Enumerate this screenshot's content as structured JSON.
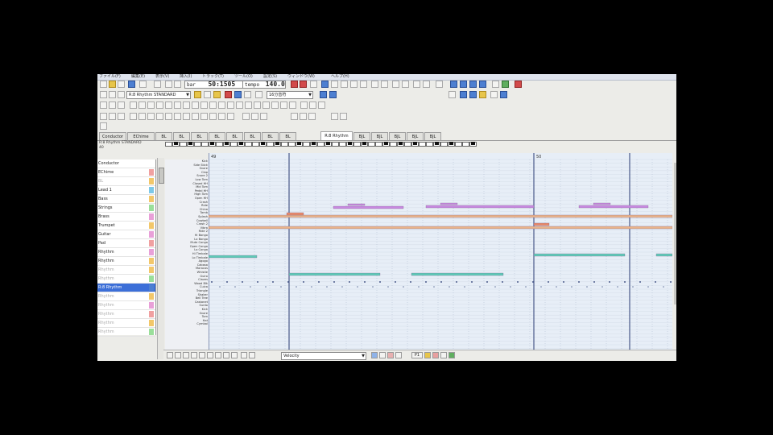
{
  "app": {
    "menu": [
      "ファイル(F)",
      "編集(E)",
      "表示(V)",
      "挿入(I)",
      "トラック(T)",
      "ツール(O)",
      "設定(S)",
      "ウィンドウ(W)",
      "ヘルプ(H)"
    ]
  },
  "transport": {
    "position_label": "bar",
    "position_value": "50:1505",
    "tempo_label": "tempo",
    "tempo_value": "140.00",
    "instrument_combo": "R:8 Rhythm STANDARD",
    "quantize_combo": "16分音符"
  },
  "tabs": [
    "Conductor",
    "EChime",
    "BL",
    "BL",
    "BL",
    "BL",
    "BL",
    "BL",
    "BL",
    "BL",
    "R:8 Rhythm",
    "BJL",
    "BJL",
    "BJL",
    "BJL",
    "BJL"
  ],
  "subheader": {
    "line1": "R:8 Rhythm STANDARD",
    "line2": "40"
  },
  "tracks": [
    {
      "label": "Conductor",
      "color": "#ffffff",
      "state": "normal"
    },
    {
      "label": "EChime",
      "color": "#f0a0a0",
      "state": "normal"
    },
    {
      "label": "BL",
      "color": "#f2c76a",
      "state": "dim"
    },
    {
      "label": "Lead 1",
      "color": "#7cc8e8",
      "state": "normal"
    },
    {
      "label": "Bass",
      "color": "#f2c76a",
      "state": "normal"
    },
    {
      "label": "Strings",
      "color": "#9adf9a",
      "state": "normal"
    },
    {
      "label": "Brass",
      "color": "#e8a0d8",
      "state": "normal"
    },
    {
      "label": "Trumpet",
      "color": "#f2c76a",
      "state": "normal"
    },
    {
      "label": "Guitar",
      "color": "#e8a0d8",
      "state": "normal"
    },
    {
      "label": "Pad",
      "color": "#f0a0a0",
      "state": "normal"
    },
    {
      "label": "Rhythm",
      "color": "#e8a0d8",
      "state": "normal"
    },
    {
      "label": "Rhythm",
      "color": "#f2c76a",
      "state": "normal"
    },
    {
      "label": "Rhythm",
      "color": "#f2c76a",
      "state": "dim"
    },
    {
      "label": "Rhythm",
      "color": "#9adf9a",
      "state": "dim"
    },
    {
      "label": "R:8 Rhythm",
      "color": "#4d7fd1",
      "state": "selected"
    },
    {
      "label": "Rhythm",
      "color": "#f2c76a",
      "state": "dim"
    },
    {
      "label": "Rhythm",
      "color": "#e8a0d8",
      "state": "dim"
    },
    {
      "label": "Rhythm",
      "color": "#f0a0a0",
      "state": "dim"
    },
    {
      "label": "Rhythm",
      "color": "#f2c76a",
      "state": "dim"
    },
    {
      "label": "Rhythm",
      "color": "#9adf9a",
      "state": "dim"
    }
  ],
  "note_names": [
    "Kick",
    "Side Stick",
    "Snare",
    "Clap",
    "Snare 2",
    "Low Tom",
    "Closed HH",
    "Mid Tom",
    "Pedal HH",
    "High Tom",
    "Open HH",
    "Crash",
    "Ride",
    "China",
    "Tamb",
    "Splash",
    "Cowbell",
    "Crash 2",
    "Vibra",
    "Ride 2",
    "Hi Bongo",
    "Lo Bongo",
    "Mute Conga",
    "Open Conga",
    "Lo Conga",
    "Hi Timbale",
    "Lo Timbale",
    "Agogo",
    "Cabasa",
    "Maracas",
    "Whistle",
    "Guiro",
    "Claves",
    "Wood Blk",
    "Cuica",
    "Triangle",
    "Shaker",
    "Bell Tree",
    "Castanet",
    "Surdo",
    "Kick",
    "Snare",
    "Tom",
    "Hat",
    "Cymbal"
  ],
  "ruler": {
    "bar_a": "49",
    "bar_b": "50"
  },
  "bottom": {
    "velocity_combo": "Velocity",
    "page_label": "P1"
  },
  "colors": {
    "roll_bg": "#e7eef7",
    "note_purple": "#c88ae0",
    "note_orange": "#e9b48a",
    "note_teal": "#5fcab8",
    "bar_line": "#4a5a8a",
    "selected_track": "#3c6fd8"
  }
}
